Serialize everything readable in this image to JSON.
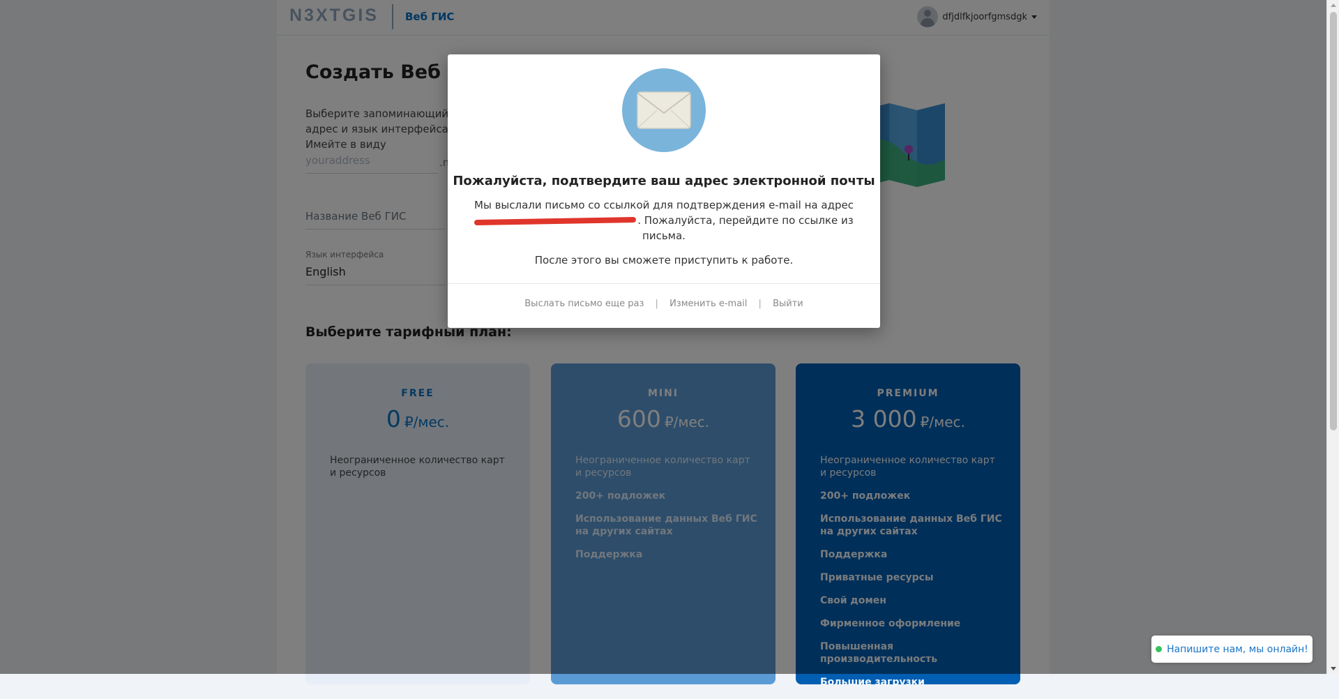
{
  "header": {
    "logo": "N3XTGIS",
    "product": "Веб ГИС",
    "username": "dfjdlfkjoorfgmsdgk"
  },
  "form": {
    "title": "Создать Веб ГИС",
    "intro": "Выберите запоминающийся адрес и язык интерфейса. Имейте в виду",
    "address_placeholder": "youraddress",
    "domain_suffix": ".n",
    "name_placeholder": "Название Веб ГИС",
    "language_label": "Язык интерфейса",
    "language_value": "English"
  },
  "plans_title": "Выберите тарифный план:",
  "plans": [
    {
      "name": "FREE",
      "price": "0",
      "unit": "₽/мес.",
      "features": [
        "Неограниченное количество карт и ресурсов"
      ]
    },
    {
      "name": "MINI",
      "price": "600",
      "unit": "₽/мес.",
      "features": [
        "Неограниченное количество карт и ресурсов",
        "200+ подложек",
        "Использование данных Веб ГИС на других сайтах",
        "Поддержка"
      ]
    },
    {
      "name": "PREMIUM",
      "price": "3 000",
      "unit": "₽/мес.",
      "features": [
        "Неограниченное количество карт и ресурсов",
        "200+ подложек",
        "Использование данных Веб ГИС на других сайтах",
        "Поддержка",
        "Приватные ресурсы",
        "Свой домен",
        "Фирменное оформление",
        "Повышенная производительность",
        "Большие загрузки"
      ]
    }
  ],
  "modal": {
    "title": "Пожалуйста, подтвердите ваш адрес электронной почты",
    "text_part1": "Мы выслали письмо со ссылкой для подтверждения e-mail на адрес",
    "text_part2": ". Пожалуйста, перейдите по ссылке из письма.",
    "text_after": "После этого вы сможете приступить к работе.",
    "resend_link": "Выслать письмо еще раз",
    "change_email_link": "Изменить e-mail",
    "logout_link": "Выйти",
    "separator": "|"
  },
  "chat": {
    "label": "Напишите нам, мы онлайн!"
  },
  "colors": {
    "brand_blue": "#0070c5",
    "plan_free_bg": "#e7eef7",
    "plan_mini_bg": "#5b9bd5",
    "plan_premium_bg": "#015eb2",
    "envelope_circle": "#7ab4db",
    "redaction": "#e0352b",
    "online_dot": "#37c15e"
  }
}
